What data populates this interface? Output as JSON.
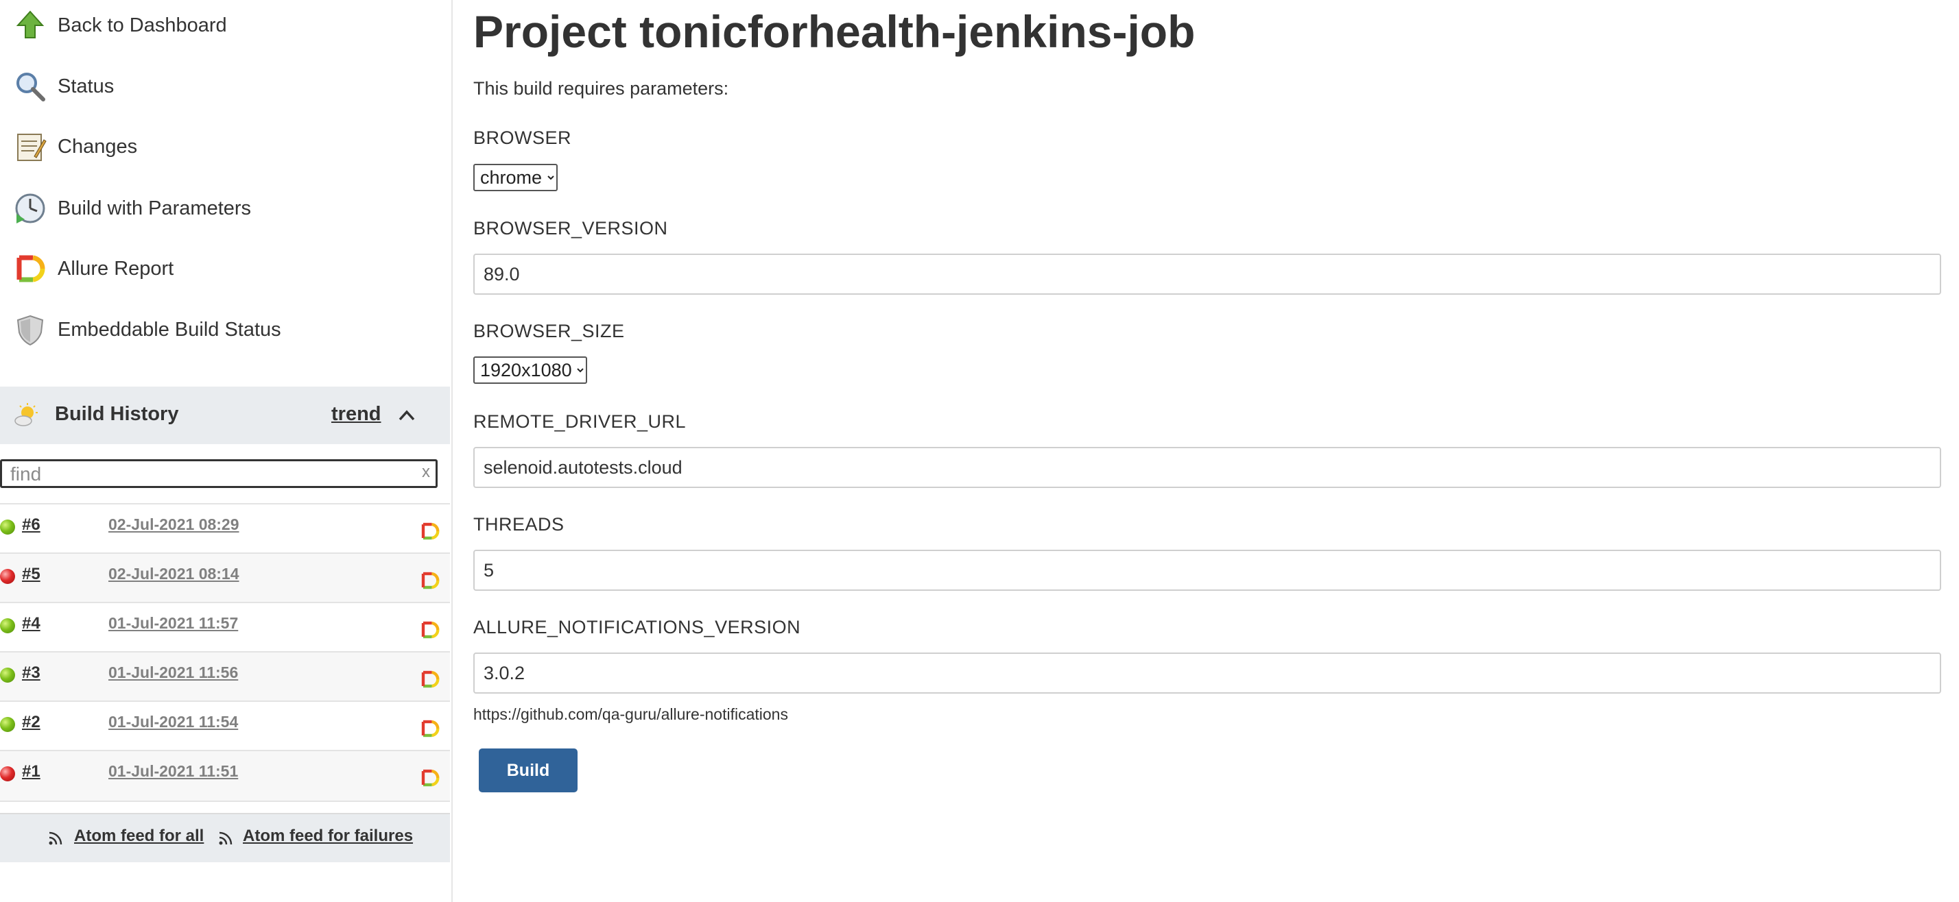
{
  "sidebar": {
    "tasks": [
      {
        "label": "Back to Dashboard",
        "icon": "up-arrow-icon"
      },
      {
        "label": "Status",
        "icon": "magnifier-icon"
      },
      {
        "label": "Changes",
        "icon": "notepad-icon"
      },
      {
        "label": "Build with Parameters",
        "icon": "clock-play-icon"
      },
      {
        "label": "Allure Report",
        "icon": "allure-icon"
      },
      {
        "label": "Embeddable Build Status",
        "icon": "shield-icon"
      }
    ]
  },
  "build_history": {
    "title": "Build History",
    "trend_label": "trend",
    "find_placeholder": "find",
    "clear_label": "x",
    "builds": [
      {
        "number": "#6",
        "date": "02-Jul-2021 08:29",
        "status": "success"
      },
      {
        "number": "#5",
        "date": "02-Jul-2021 08:14",
        "status": "failure"
      },
      {
        "number": "#4",
        "date": "01-Jul-2021 11:57",
        "status": "success"
      },
      {
        "number": "#3",
        "date": "01-Jul-2021 11:56",
        "status": "success"
      },
      {
        "number": "#2",
        "date": "01-Jul-2021 11:54",
        "status": "success"
      },
      {
        "number": "#1",
        "date": "01-Jul-2021 11:51",
        "status": "failure"
      }
    ],
    "feeds": {
      "all_label": "Atom feed for all",
      "failures_label": "Atom feed for failures"
    }
  },
  "main": {
    "title": "Project tonicforhealth-jenkins-job",
    "requires_text": "This build requires parameters:",
    "params": {
      "browser": {
        "label": "BROWSER",
        "value": "chrome"
      },
      "browser_version": {
        "label": "BROWSER_VERSION",
        "value": "89.0"
      },
      "browser_size": {
        "label": "BROWSER_SIZE",
        "value": "1920x1080"
      },
      "remote_driver_url": {
        "label": "REMOTE_DRIVER_URL",
        "value": "selenoid.autotests.cloud"
      },
      "threads": {
        "label": "THREADS",
        "value": "5"
      },
      "allure_notifications_version": {
        "label": "ALLURE_NOTIFICATIONS_VERSION",
        "value": "3.0.2",
        "description": "https://github.com/qa-guru/allure-notifications"
      }
    },
    "build_button_label": "Build"
  },
  "colors": {
    "build_button": "#306399",
    "sidebar_header_bg": "#e9ecef",
    "success_ball": "#7dbf1a",
    "failure_ball": "#e02b2b",
    "date_text": "#808080"
  }
}
